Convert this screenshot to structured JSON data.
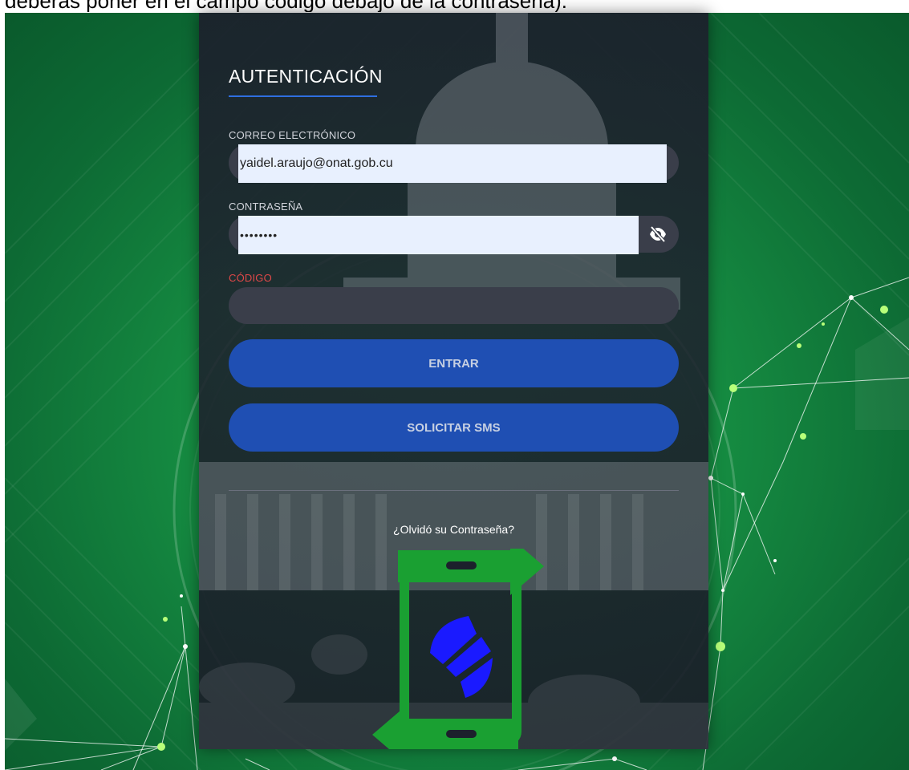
{
  "caption": {
    "text": "deberás poner en el campo código debajo de la contraseña)."
  },
  "login": {
    "title": "AUTENTICACIÓN",
    "email": {
      "label": "CORREO ELECTRÓNICO",
      "value": "yaidel.araujo@onat.gob.cu"
    },
    "password": {
      "label": "CONTRASEÑA",
      "value": "••••••••",
      "toggle_icon": "eye-slash-icon"
    },
    "code": {
      "label": "CÓDIGO",
      "value": ""
    },
    "buttons": {
      "enter": "ENTRAR",
      "request_sms": "SOLICITAR SMS"
    },
    "forgot_link": "¿Olvidó su Contraseña?",
    "logo_icon": "phone-sync-arrows-logo-icon"
  },
  "colors": {
    "background_green": "#179244",
    "panel": "#1c202c",
    "accent_blue": "#2f6fe0",
    "button_blue": "#1f4fb3",
    "field_bg": "#3a3e4a",
    "autofill_bg": "#e8f0fe",
    "required_label": "#e04848",
    "logo_green": "#1aa032",
    "logo_blue": "#1a1aff"
  }
}
